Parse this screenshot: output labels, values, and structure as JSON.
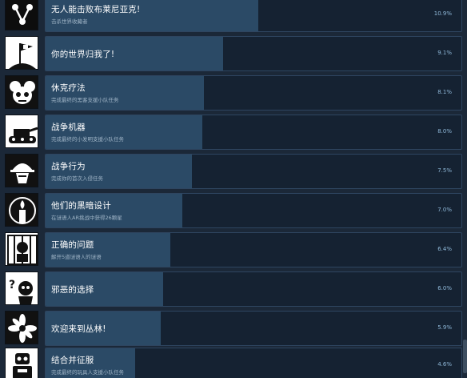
{
  "achievements": [
    {
      "title": "无人能击败布莱尼亚克!",
      "desc": "击杀世界收藏者",
      "pct": "10.9%",
      "fill": 10.9,
      "icon": "network-nodes-icon"
    },
    {
      "title": "你的世界归我了!",
      "desc": "",
      "pct": "9.1%",
      "fill": 9.1,
      "icon": "flag-on-globe-icon"
    },
    {
      "title": "休克疗法",
      "desc": "完成最终的黑客支援小队任务",
      "pct": "8.1%",
      "fill": 8.1,
      "icon": "skull-mask-icon"
    },
    {
      "title": "战争机器",
      "desc": "完成最终的小发明支援小队任务",
      "pct": "8.0%",
      "fill": 8.0,
      "icon": "tank-icon"
    },
    {
      "title": "战争行为",
      "desc": "完成你的首次入侵任务",
      "pct": "7.5%",
      "fill": 7.5,
      "icon": "soldier-helmet-icon"
    },
    {
      "title": "他们的黑暗设计",
      "desc": "在谜语人AR挑战中获得26颗星",
      "pct": "7.0%",
      "fill": 7.0,
      "icon": "candle-icon"
    },
    {
      "title": "正确的问题",
      "desc": "解开5道谜语人的谜语",
      "pct": "6.4%",
      "fill": 6.4,
      "icon": "caged-riddler-icon"
    },
    {
      "title": "邪恶的选择",
      "desc": "",
      "pct": "6.0%",
      "fill": 6.0,
      "icon": "question-mark-villain-icon"
    },
    {
      "title": "欢迎来到丛林!",
      "desc": "",
      "pct": "5.9%",
      "fill": 5.9,
      "icon": "jungle-flower-icon"
    },
    {
      "title": "结合并征服",
      "desc": "完成最终的玩具人支援小队任务",
      "pct": "4.6%",
      "fill": 4.6,
      "icon": "robot-toy-icon"
    }
  ]
}
